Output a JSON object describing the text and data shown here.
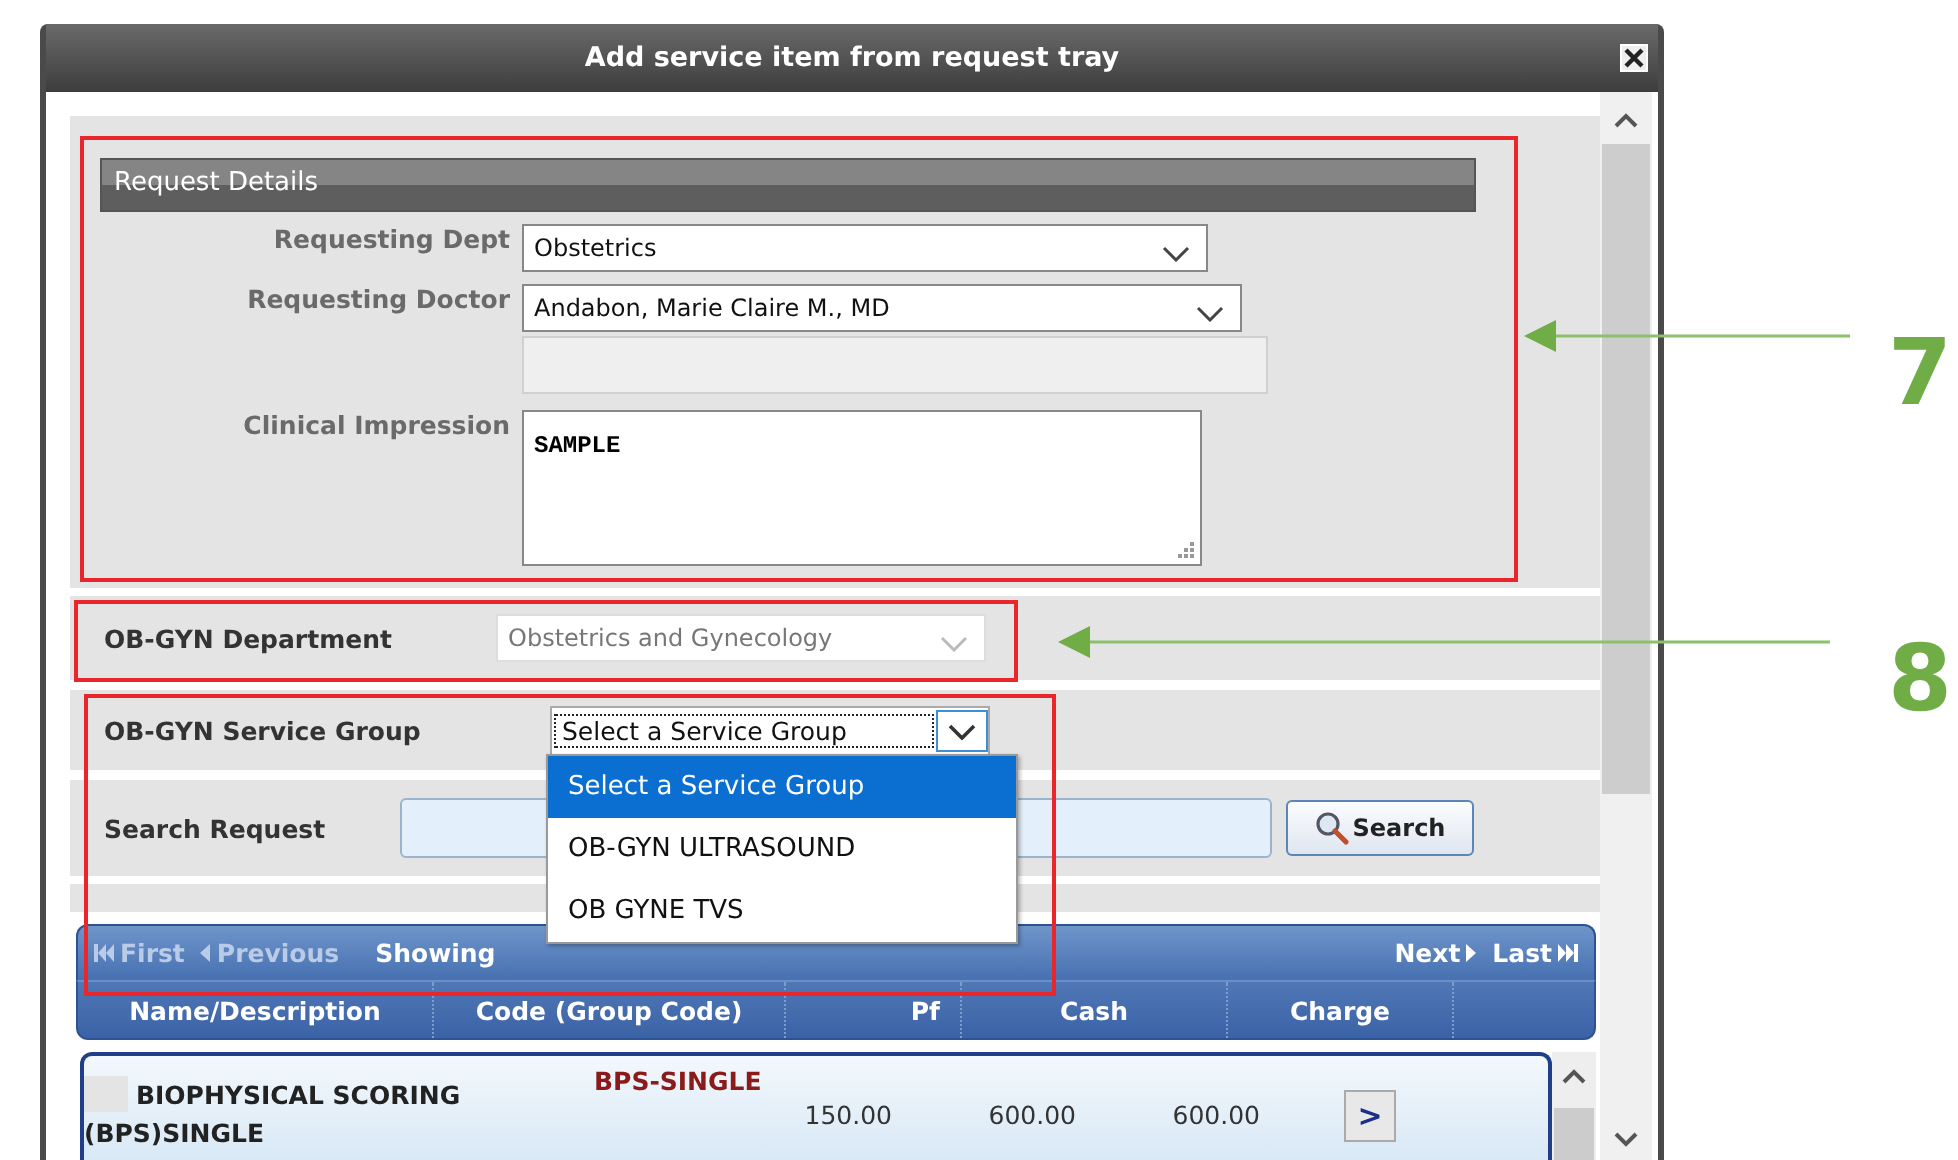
{
  "dialog": {
    "title": "Add service item from request tray"
  },
  "request_details": {
    "heading": "Request Details",
    "fields": [
      {
        "kind": "select",
        "label": "Requesting Dept",
        "value": "Obstetrics"
      },
      {
        "kind": "select",
        "label": "Requesting Doctor",
        "value": "Andabon, Marie Claire M., MD"
      },
      {
        "kind": "blank"
      },
      {
        "kind": "textarea",
        "label": "Clinical Impression",
        "value": "SAMPLE"
      }
    ]
  },
  "department": {
    "label": "OB-GYN Department",
    "value": "Obstetrics and Gynecology",
    "disabled": true
  },
  "service_group": {
    "label": "OB-GYN Service Group",
    "value": "Select a Service Group",
    "expanded": true,
    "options": [
      {
        "label": "Select a Service Group",
        "selected": true
      },
      {
        "label": "OB-GYN ULTRASOUND",
        "selected": false
      },
      {
        "label": "OB GYNE TVS",
        "selected": false
      }
    ]
  },
  "search": {
    "label": "Search Request",
    "button": "Search"
  },
  "pager": {
    "status": "Showing",
    "links": [
      {
        "kind": "first",
        "label": "First",
        "disabled": true
      },
      {
        "kind": "previous",
        "label": "Previous",
        "disabled": true
      },
      {
        "kind": "next",
        "label": "Next",
        "disabled": false
      },
      {
        "kind": "last",
        "label": "Last",
        "disabled": false
      }
    ]
  },
  "table": {
    "columns": [
      "Name/Description",
      "Code (Group Code)",
      "Pf",
      "Cash",
      "Charge"
    ],
    "rows": [
      {
        "cells": [
          "BIOPHYSICAL SCORING (BPS)SINGLE",
          "BPS-SINGLE",
          "150.00",
          "600.00",
          "600.00"
        ],
        "action": ">"
      }
    ]
  },
  "annotations": [
    {
      "number": "7"
    },
    {
      "number": "8"
    }
  ]
}
